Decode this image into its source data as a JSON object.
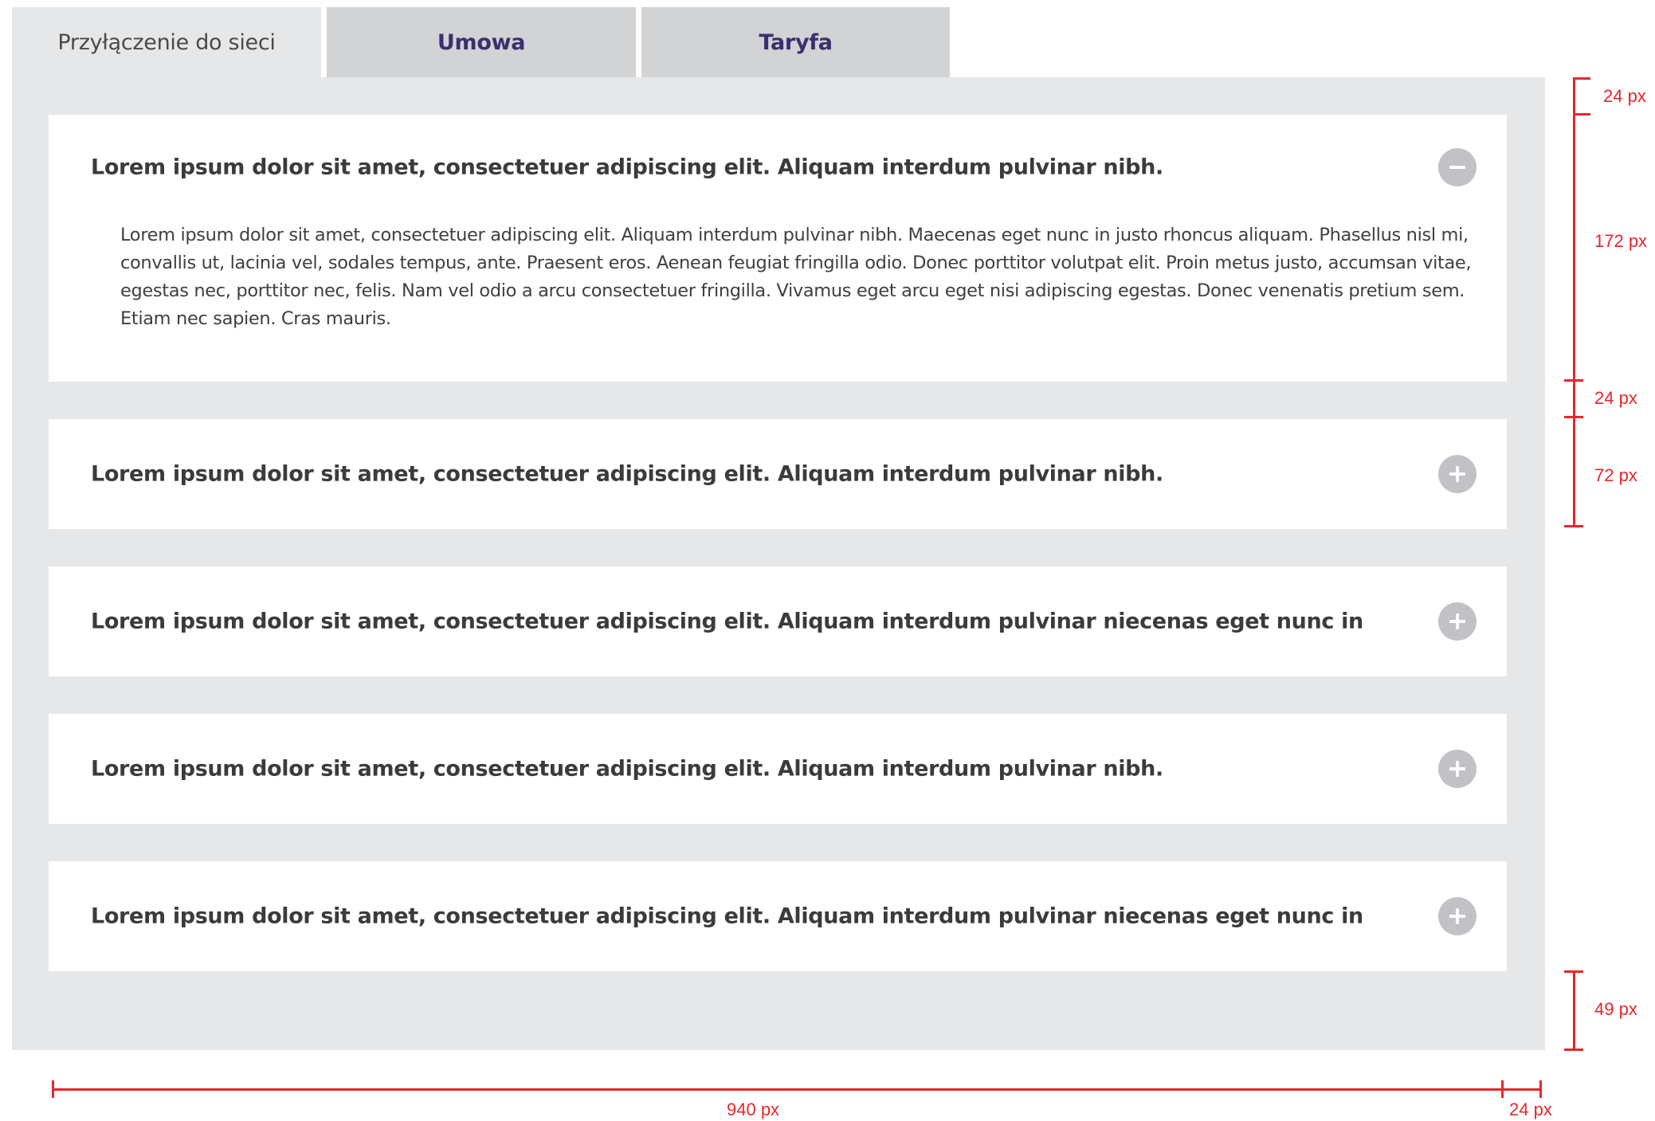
{
  "tabs": [
    {
      "label": "Przyłączenie do sieci",
      "active": true
    },
    {
      "label": "Umowa",
      "active": false
    },
    {
      "label": "Taryfa",
      "active": false
    }
  ],
  "accordion": {
    "items": [
      {
        "title": "Lorem ipsum dolor sit amet, consectetuer adipiscing elit. Aliquam interdum pulvinar nibh.",
        "expanded": true,
        "toggle_icon": "minus-icon",
        "body": "Lorem ipsum dolor sit amet, consectetuer adipiscing elit. Aliquam interdum pulvinar nibh. Maecenas eget nunc in justo rhoncus aliquam. Phasellus nisl mi, convallis ut, lacinia vel, sodales tempus, ante. Praesent eros. Aenean feugiat fringilla odio. Donec porttitor volutpat elit. Proin metus justo, accumsan vitae, egestas nec, porttitor nec, felis. Nam vel odio a arcu consectetuer fringilla. Vivamus eget arcu eget nisi adipiscing egestas. Donec venenatis pretium sem. Etiam nec sapien. Cras mauris."
      },
      {
        "title": "Lorem ipsum dolor sit amet, consectetuer adipiscing elit. Aliquam interdum pulvinar nibh.",
        "expanded": false,
        "toggle_icon": "plus-icon"
      },
      {
        "title": "Lorem ipsum dolor sit amet, consectetuer adipiscing elit. Aliquam interdum pulvinar niecenas eget nunc in",
        "expanded": false,
        "toggle_icon": "plus-icon"
      },
      {
        "title": "Lorem ipsum dolor sit amet, consectetuer adipiscing elit. Aliquam interdum pulvinar nibh.",
        "expanded": false,
        "toggle_icon": "plus-icon"
      },
      {
        "title": "Lorem ipsum dolor sit amet, consectetuer adipiscing elit. Aliquam interdum pulvinar niecenas eget nunc in",
        "expanded": false,
        "toggle_icon": "plus-icon"
      }
    ]
  },
  "annotations": {
    "top_gap": "24 px",
    "expanded_height": "172 px",
    "item_gap": "24 px",
    "collapsed_height": "72 px",
    "bottom_gap": "49 px",
    "content_width": "940 px",
    "side_padding": "24 px"
  },
  "colors": {
    "panel_bg": "#e6e7e9",
    "tab_inactive_bg": "#d1d3d5",
    "tab_inactive_text": "#3d2f6e",
    "toggle_bg": "#c0c2c5",
    "annotation": "#e8262a"
  }
}
